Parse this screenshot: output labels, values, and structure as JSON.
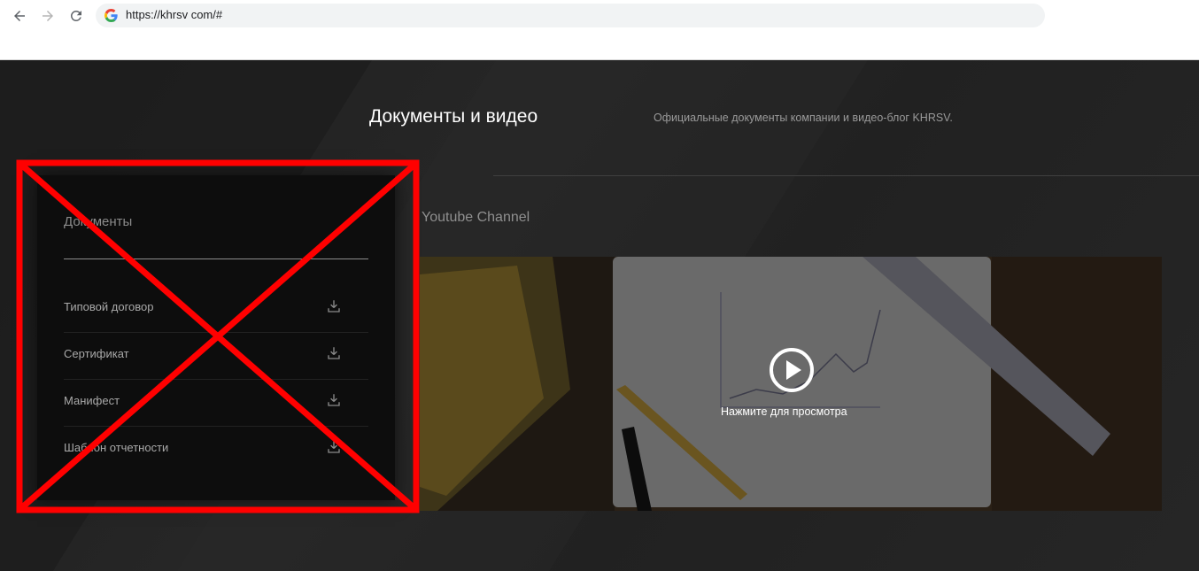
{
  "browser": {
    "url": "https://khrsv com/#",
    "icons": {
      "back": "arrow-left-icon",
      "forward": "arrow-right-icon",
      "reload": "reload-icon",
      "site": "google-g-icon"
    }
  },
  "hero": {
    "title": "Документы и видео",
    "subtitle": "Официальные документы компании и видео-блог KHRSV."
  },
  "documents": {
    "heading": "Документы",
    "items": [
      {
        "label": "Типовой договор",
        "icon": "download-icon"
      },
      {
        "label": "Сертификат",
        "icon": "download-icon"
      },
      {
        "label": "Манифест",
        "icon": "download-icon"
      },
      {
        "label": "Шаблон отчетности",
        "icon": "download-icon"
      }
    ]
  },
  "youtube": {
    "heading": "Youtube Channel",
    "play_label": "Нажмите для просмотра",
    "play_icon": "play-circle-icon"
  },
  "colors": {
    "page_bg": "#222222",
    "panel_bg": "#0d0d0d",
    "cross_red": "#ff0000",
    "text_white": "#ffffff"
  }
}
